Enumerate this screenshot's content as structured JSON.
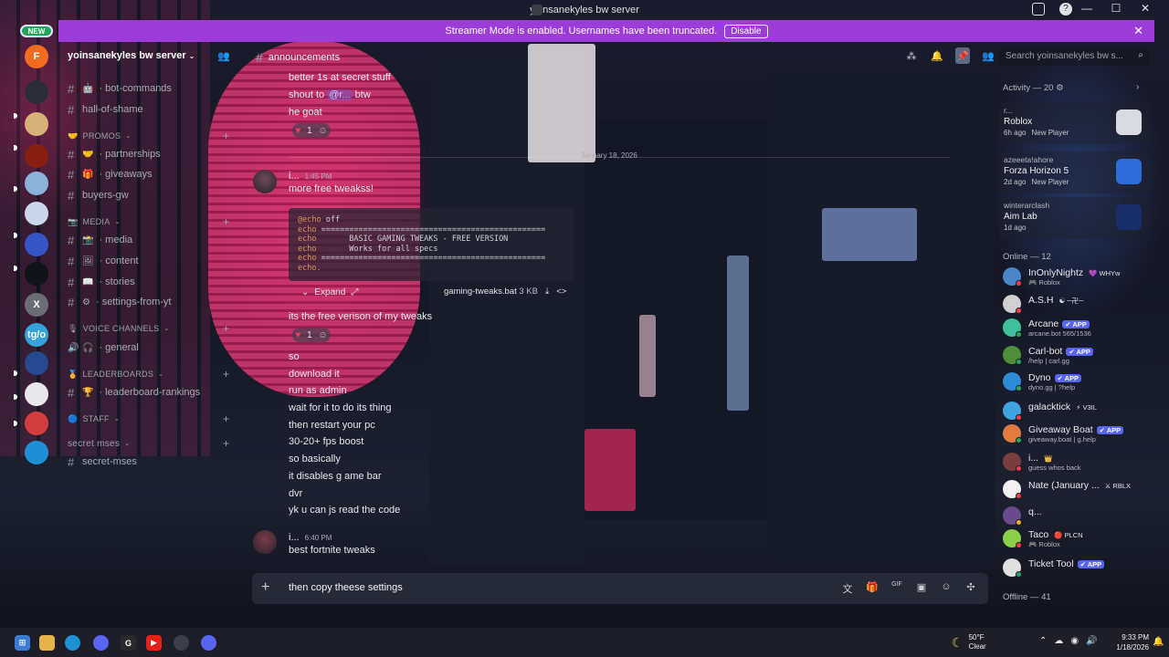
{
  "window": {
    "title": "yoinsanekyles bw server",
    "controls": [
      "—",
      "☐",
      "✕"
    ]
  },
  "banner": {
    "text": "Streamer Mode is enabled. Usernames have been truncated.",
    "button": "Disable",
    "close": "✕"
  },
  "rail": {
    "new_badge": "NEW",
    "servers": [
      {
        "icon": "F",
        "color": "#f26b21"
      },
      {
        "icon": "",
        "color": "#2b2d36"
      },
      {
        "icon": "",
        "color": "#d8b27a"
      },
      {
        "icon": "",
        "color": "#8a1f10"
      },
      {
        "icon": "",
        "color": "#8ab3d9"
      },
      {
        "icon": "",
        "color": "#c9d6e8"
      },
      {
        "icon": "",
        "color": "#3556c7"
      },
      {
        "icon": "",
        "color": "#101418"
      },
      {
        "icon": "X",
        "color": "#6a6d73"
      },
      {
        "icon": "tg/o",
        "color": "#34a3d9"
      },
      {
        "icon": "",
        "color": "#254a8f"
      },
      {
        "icon": "",
        "color": "#e8e8ec"
      },
      {
        "icon": "",
        "color": "#d23d3d"
      },
      {
        "icon": "",
        "color": "#1e8fd6"
      }
    ]
  },
  "channels": {
    "server_name": "yoinsanekyles bw server",
    "items": [
      {
        "type": "channel",
        "emoji": "🤖",
        "label": "· bot-commands"
      },
      {
        "type": "channel",
        "emoji": "",
        "label": "hall-of-shame"
      },
      {
        "type": "category",
        "emoji": "🤝",
        "label": "PROMOS"
      },
      {
        "type": "channel",
        "emoji": "🤝",
        "label": "· partnerships"
      },
      {
        "type": "channel",
        "emoji": "🎁",
        "label": "· giveaways"
      },
      {
        "type": "channel",
        "emoji": "",
        "label": "buyers-gw"
      },
      {
        "type": "category",
        "emoji": "📷",
        "label": "MEDIA"
      },
      {
        "type": "channel",
        "emoji": "📸",
        "label": "· media"
      },
      {
        "type": "channel",
        "emoji": "🖼",
        "label": "· content"
      },
      {
        "type": "channel",
        "emoji": "📖",
        "label": "· stories"
      },
      {
        "type": "channel",
        "emoji": "⚙",
        "label": "· settings-from-yt"
      },
      {
        "type": "category",
        "emoji": "🎙",
        "label": "VOICE CHANNELS"
      },
      {
        "type": "voice",
        "emoji": "🎧",
        "label": "· general"
      },
      {
        "type": "category",
        "emoji": "🏅",
        "label": "LEADERBOARDS"
      },
      {
        "type": "channel",
        "emoji": "🏆",
        "label": "· leaderboard-rankings"
      },
      {
        "type": "category",
        "emoji": "🔵",
        "label": "STAFF"
      },
      {
        "type": "category-plain",
        "emoji": "",
        "label": "secret mses"
      },
      {
        "type": "channel",
        "emoji": "",
        "label": "secret-mses"
      }
    ]
  },
  "chat": {
    "channel": "announcements",
    "messages_top": [
      {
        "text": "better 1s at secret stuff"
      },
      {
        "pre": "shout to ",
        "mention": "@r...",
        "post": " btw"
      },
      {
        "text": "he goat"
      }
    ],
    "reaction1": {
      "emoji": "♥",
      "count": "1",
      "add": "☺"
    },
    "date_divider": "January 18, 2026",
    "msg2": {
      "author": "i...",
      "time": "1:45 PM",
      "text": "more free tweakss!",
      "code_lines": [
        [
          "@echo",
          " off"
        ],
        [
          "echo",
          " ================================================"
        ],
        [
          "echo",
          "       BASIC GAMING TWEAKS - FREE VERSION"
        ],
        [
          "echo",
          "       Works for all specs"
        ],
        [
          "echo",
          " ================================================"
        ],
        [
          "echo.",
          ""
        ]
      ],
      "expand": "Expand",
      "attachment_name": "gaming-tweaks.bat",
      "attachment_size": "3 KB",
      "after": "its the free verison of my tweaks",
      "reaction": {
        "emoji": "♥",
        "count": "1",
        "add": "☺"
      },
      "lines": [
        "so",
        "download it",
        "run as admin",
        "wait for it to do its  thing",
        "then restart  your pc",
        "30-20+ fps boost",
        "so basically",
        "it disables g ame bar",
        "dvr",
        "yk u can js read the code"
      ]
    },
    "msg3": {
      "author": "i...",
      "time": "6:40 PM",
      "text": "best fortnite tweaks"
    },
    "composer_text": "then copy theese settings",
    "composer_tools": [
      "文",
      "🎁",
      "GIF",
      "▣",
      "☺",
      "✣"
    ]
  },
  "right": {
    "search_placeholder": "Search yoinsanekyles bw s...",
    "activity_head": "Activity — 20",
    "activity": [
      {
        "who": "r...",
        "game": "Roblox",
        "ago": "6h ago",
        "tag": "New Player",
        "icon_color": "#d8dbe0"
      },
      {
        "who": "azeeeta!ahore",
        "game": "Forza Horizon 5",
        "ago": "2d ago",
        "tag": "New Player",
        "icon_color": "#2d6bd8"
      },
      {
        "who": "winterarclash",
        "game": "Aim Lab",
        "ago": "1d ago",
        "tag": "",
        "icon_color": "#1a2d6b"
      }
    ],
    "online_head": "Online — 12",
    "members": [
      {
        "name": "InOnlyNightz",
        "tag": "💜 WHYw",
        "sub": "🎮 Roblox",
        "color": "#4a86c8",
        "status": "#f23f43",
        "app": false
      },
      {
        "name": "A.S.H",
        "tag": "☯ ─卍─",
        "sub": "",
        "color": "#d0d0d0",
        "status": "#f23f43",
        "app": false
      },
      {
        "name": "Arcane",
        "tag": "✔ APP",
        "sub": "arcane.bot 565/1536",
        "color": "#3dbf9a",
        "status": "#23a55a",
        "app": true
      },
      {
        "name": "Carl-bot",
        "tag": "✔ APP",
        "sub": "/help | carl.gg",
        "color": "#4f8f3b",
        "status": "#23a55a",
        "app": true
      },
      {
        "name": "Dyno",
        "tag": "✔ APP",
        "sub": "dyno.gg | ?help",
        "color": "#2e8bd6",
        "status": "#23a55a",
        "app": true
      },
      {
        "name": "galacktick",
        "tag": "⚡ V3IL",
        "sub": "",
        "color": "#3ea3e0",
        "status": "#f23f43",
        "app": false
      },
      {
        "name": "Giveaway Boat",
        "tag": "✔ APP",
        "sub": "giveaway.boat | g.help",
        "color": "#e07a3e",
        "status": "#23a55a",
        "app": true
      },
      {
        "name": "i...",
        "tag": "👑",
        "sub": "guess whos back",
        "color": "#7a3e3e",
        "status": "#f23f43",
        "app": false
      },
      {
        "name": "Nate (January ...",
        "tag": "⚔ RBLX",
        "sub": "",
        "color": "#f0f0f0",
        "status": "#f23f43",
        "app": false
      },
      {
        "name": "q...",
        "tag": "",
        "sub": "",
        "color": "#6a4a8a",
        "status": "#f0b232",
        "app": false
      },
      {
        "name": "Taco",
        "tag": "🔴 PLCN",
        "sub": "🎮 Roblox",
        "color": "#8ad04a",
        "status": "#f23f43",
        "app": false
      },
      {
        "name": "Ticket Tool",
        "tag": "✔ APP",
        "sub": "",
        "color": "#e0e0e0",
        "status": "#23a55a",
        "app": true
      }
    ],
    "offline_head": "Offline — 41"
  },
  "taskbar": {
    "weather_temp": "50°F",
    "weather_desc": "Clear",
    "time": "9:33 PM",
    "date": "1/18/2026"
  }
}
